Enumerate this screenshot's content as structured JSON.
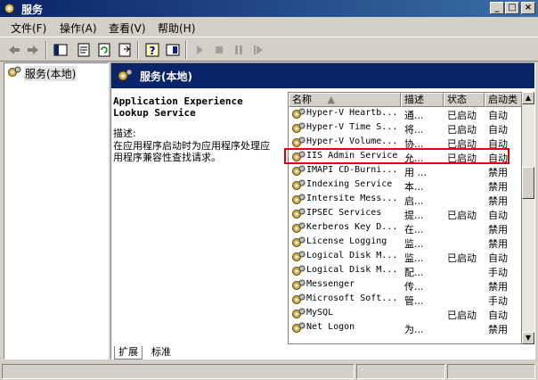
{
  "window": {
    "title": "服务"
  },
  "menu": [
    "文件(F)",
    "操作(A)",
    "查看(V)",
    "帮助(H)"
  ],
  "tree": {
    "root": "服务(本地)"
  },
  "pane": {
    "title": "服务(本地)"
  },
  "description": {
    "service_name_line1": "Application Experience",
    "service_name_line2": "Lookup Service",
    "label": "描述:",
    "line1": "在应用程序启动时为应用程序处理应",
    "line2": "用程序兼容性查找请求。"
  },
  "columns": {
    "name": "名称",
    "desc": "描述",
    "status": "状态",
    "startup": "启动类"
  },
  "services": [
    {
      "name": "Hyper-V Heartb...",
      "desc": "通...",
      "status": "已启动",
      "startup": "自动"
    },
    {
      "name": "Hyper-V Time S...",
      "desc": "将...",
      "status": "已启动",
      "startup": "自动"
    },
    {
      "name": "Hyper-V Volume...",
      "desc": "协...",
      "status": "已启动",
      "startup": "自动"
    },
    {
      "name": "IIS Admin Service",
      "desc": "允...",
      "status": "已启动",
      "startup": "自动"
    },
    {
      "name": "IMAPI CD-Burni...",
      "desc": "用 ...",
      "status": "",
      "startup": "禁用"
    },
    {
      "name": "Indexing Service",
      "desc": "本...",
      "status": "",
      "startup": "禁用"
    },
    {
      "name": "Intersite Mess...",
      "desc": "启...",
      "status": "",
      "startup": "禁用"
    },
    {
      "name": "IPSEC Services",
      "desc": "提...",
      "status": "已启动",
      "startup": "自动"
    },
    {
      "name": "Kerberos Key D...",
      "desc": "在...",
      "status": "",
      "startup": "禁用"
    },
    {
      "name": "License Logging",
      "desc": "监...",
      "status": "",
      "startup": "禁用"
    },
    {
      "name": "Logical Disk M...",
      "desc": "监...",
      "status": "已启动",
      "startup": "自动"
    },
    {
      "name": "Logical Disk M...",
      "desc": "配...",
      "status": "",
      "startup": "手动"
    },
    {
      "name": "Messenger",
      "desc": "传...",
      "status": "",
      "startup": "禁用"
    },
    {
      "name": "Microsoft Soft...",
      "desc": "管...",
      "status": "",
      "startup": "手动"
    },
    {
      "name": "MySQL",
      "desc": "",
      "status": "已启动",
      "startup": "自动"
    },
    {
      "name": "Net Logon",
      "desc": "为...",
      "status": "",
      "startup": "禁用"
    }
  ],
  "tabs": [
    "扩展",
    "标准"
  ],
  "colors": {
    "highlight_border": "#e00000",
    "header_bg": "#0a246a"
  }
}
